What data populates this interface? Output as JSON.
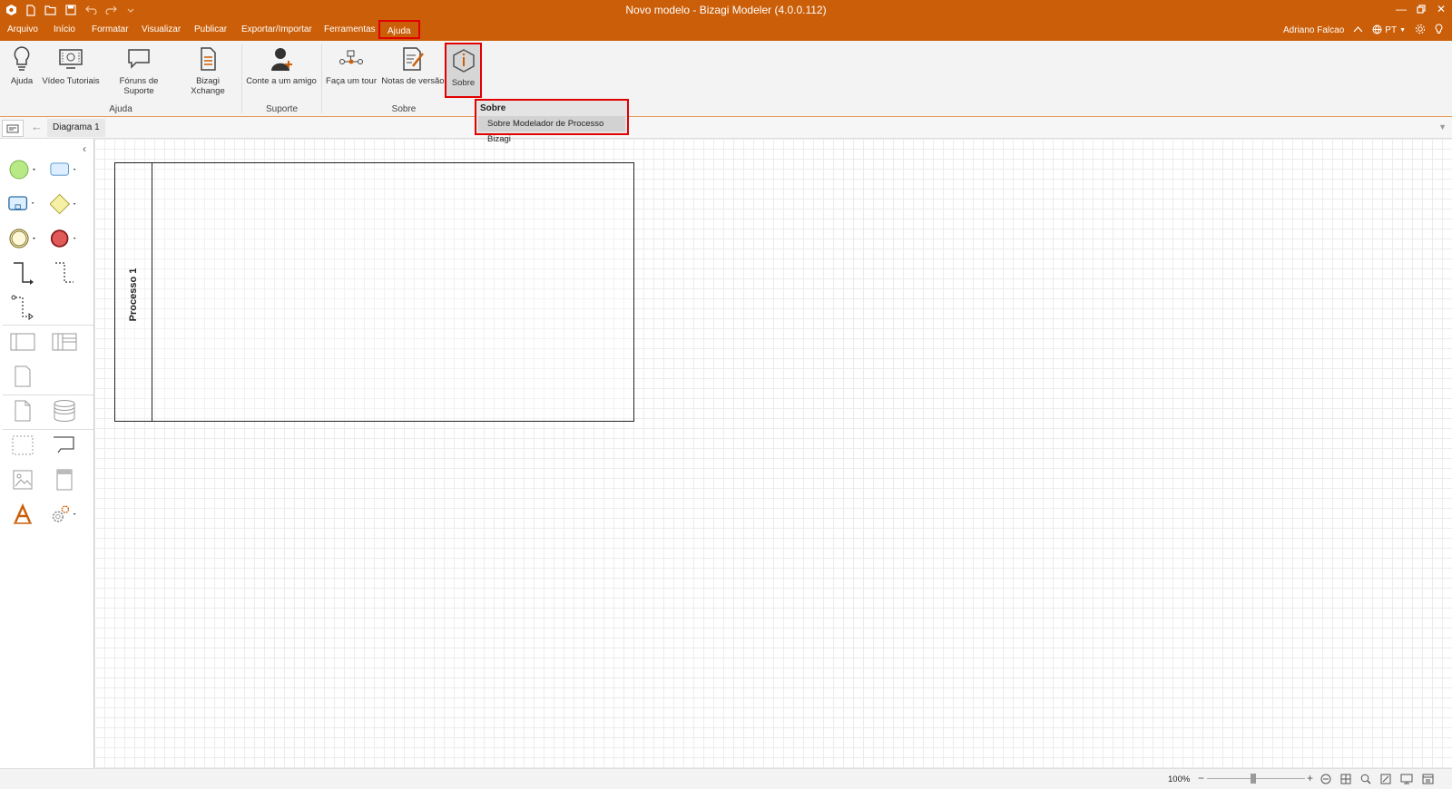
{
  "window": {
    "title": "Novo modelo - Bizagi Modeler (4.0.0.112)"
  },
  "menu": {
    "items": [
      "Arquivo",
      "Início",
      "Formatar",
      "Visualizar",
      "Publicar",
      "Exportar/Importar",
      "Ferramentas",
      "Ajuda"
    ],
    "active": "Ajuda"
  },
  "user": {
    "name": "Adriano Falcao",
    "language": "PT"
  },
  "ribbon": {
    "buttons": [
      "Ajuda",
      "Vídeo Tutoriais",
      "Fóruns de Suporte",
      "Bizagi Xchange",
      "Conte a um amigo",
      "Faça um tour",
      "Notas de versão",
      "Sobre"
    ],
    "groups": [
      "Ajuda",
      "Suporte",
      "Sobre"
    ]
  },
  "dropdown": {
    "header": "Sobre",
    "item": "Sobre  Modelador de Processo Bizagi"
  },
  "tabs": {
    "diagram": "Diagrama 1"
  },
  "canvas": {
    "pool_label": "Processo 1"
  },
  "status": {
    "zoom": "100%"
  },
  "colors": {
    "accent": "#cb5e08",
    "highlight": "#e20000",
    "start_event": "#b8e986",
    "end_event": "#e05a5a",
    "gateway": "#f5f0a6",
    "task": "#dceeff"
  }
}
